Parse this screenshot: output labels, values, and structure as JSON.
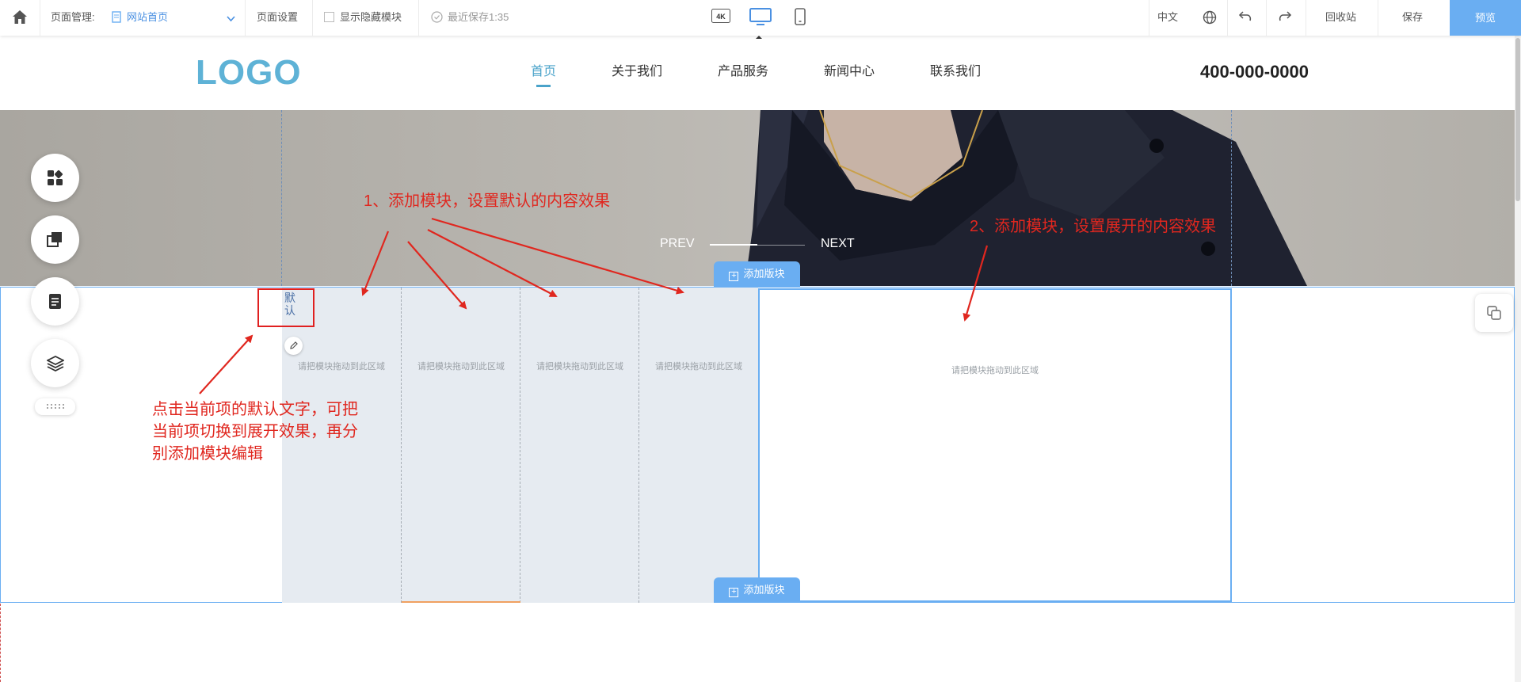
{
  "toolbar": {
    "page_manage_label": "页面管理:",
    "current_page": "网站首页",
    "page_settings": "页面设置",
    "show_hidden_modules": "显示隐藏模块",
    "last_saved": "最近保存1:35",
    "resolution_4k": "4K",
    "language": "中文",
    "recycle_bin": "回收站",
    "save": "保存",
    "preview": "预览"
  },
  "site": {
    "logo": "LOGO",
    "nav": [
      "首页",
      "关于我们",
      "产品服务",
      "新闻中心",
      "联系我们"
    ],
    "active_nav_index": 0,
    "phone": "400-000-0000"
  },
  "banner": {
    "prev": "PREV",
    "next": "NEXT"
  },
  "editor": {
    "add_block": "添加版块",
    "drop_hint": "请把模块拖动到此区域",
    "default_tab_label": "默认"
  },
  "annotations": {
    "step1": "1、添加模块，设置默认的内容效果",
    "step2": "2、添加模块，设置展开的内容效果",
    "note_line1": "点击当前项的默认文字，可把",
    "note_line2": "当前项切换到展开效果，再分",
    "note_line3": "别添加模块编辑"
  },
  "colors": {
    "accent": "#6aaef2",
    "logo": "#5eb2d6",
    "annotation_red": "#e0271f"
  }
}
